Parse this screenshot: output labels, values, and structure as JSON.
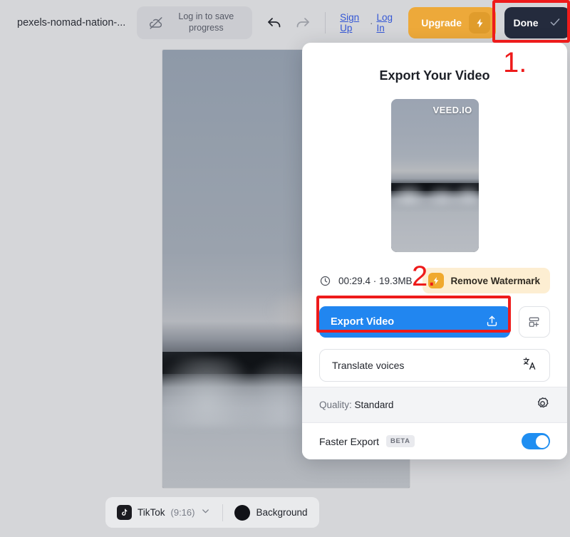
{
  "header": {
    "file_name": "pexels-nomad-nation-...",
    "save_pill_label": "Log in to save progress",
    "cloud_icon": "cloud-off-icon",
    "undo_icon": "undo-arrow-icon",
    "redo_icon": "redo-arrow-icon",
    "sign_up_label": "Sign Up",
    "separator": "·",
    "log_in_label": "Log In",
    "upgrade_label": "Upgrade",
    "upgrade_icon": "lightning-bolt-icon",
    "done_label": "Done",
    "done_icon": "check-icon",
    "upgrade_color": "#eda93a",
    "done_color": "#242b3d"
  },
  "annotations": {
    "step_one": "1.",
    "step_two": "2.",
    "color": "#ee1b1b"
  },
  "panel": {
    "title": "Export Your Video",
    "watermark": "VEED.IO",
    "duration_size": "00:29.4 · 19.3MB",
    "clock_icon": "clock-icon",
    "remove_watermark_label": "Remove Watermark",
    "remove_watermark_icon": "lightning-bolt-icon",
    "export_label": "Export Video",
    "export_icon": "upload-icon",
    "export_color": "#2186f0",
    "add_icon": "add-to-workspace-icon",
    "translate_label": "Translate voices",
    "translate_icon": "translate-icon",
    "quality_key": "Quality:",
    "quality_value": "Standard",
    "quality_icon": "gear-icon",
    "faster_export_label": "Faster Export",
    "faster_export_badge": "BETA",
    "faster_export_enabled": true,
    "toggle_color": "#1f8ef1"
  },
  "bottom_bar": {
    "preset_icon": "tiktok-icon",
    "preset_label": "TikTok",
    "preset_ratio": "(9:16)",
    "chevron_icon": "chevron-down-icon",
    "background_label": "Background",
    "background_color": "#111217"
  }
}
